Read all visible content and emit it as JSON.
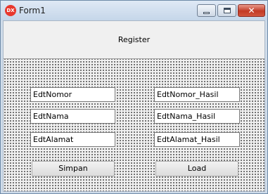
{
  "window": {
    "title": "Form1",
    "app_icon_text": "DX",
    "close_glyph": "✕"
  },
  "header": {
    "label": "Register"
  },
  "inputs_left": [
    "EdtNomor",
    "EdtNama",
    "EdtAlamat"
  ],
  "inputs_right": [
    "EdtNomor_Hasil",
    "EdtNama_Hasil",
    "EdtAlamat_Hasil"
  ],
  "buttons": {
    "save": "Simpan",
    "load": "Load"
  }
}
